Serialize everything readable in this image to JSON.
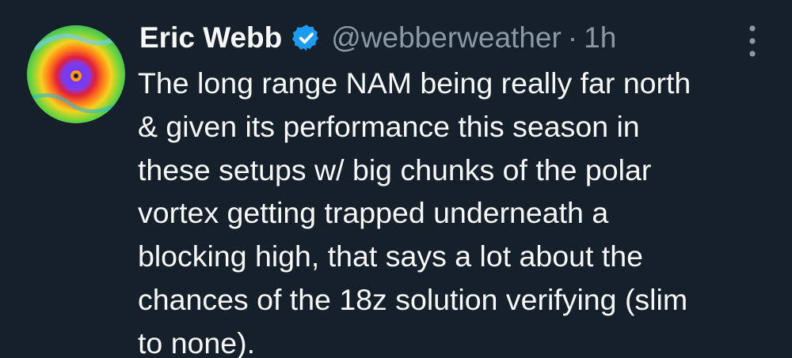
{
  "author": {
    "display_name": "Eric Webb",
    "handle": "@webberweather",
    "verified": true,
    "avatar_icon": "hurricane-radar-avatar-icon"
  },
  "meta": {
    "separator": "·",
    "timestamp": "1h"
  },
  "tweet": {
    "text": "The long range NAM being really far north\n& given its performance this season in\nthese setups w/ big chunks of the polar\nvortex getting trapped underneath a\nblocking high, that says a lot about the\nchances of the 18z solution verifying (slim\nto none)."
  },
  "icons": {
    "verified": "verified-badge-icon",
    "more": "more-options-icon"
  },
  "colors": {
    "background": "#15202b",
    "primary_text": "#f7f9f9",
    "secondary_text": "#8b98a5",
    "verified_blue": "#1d9bf0"
  }
}
